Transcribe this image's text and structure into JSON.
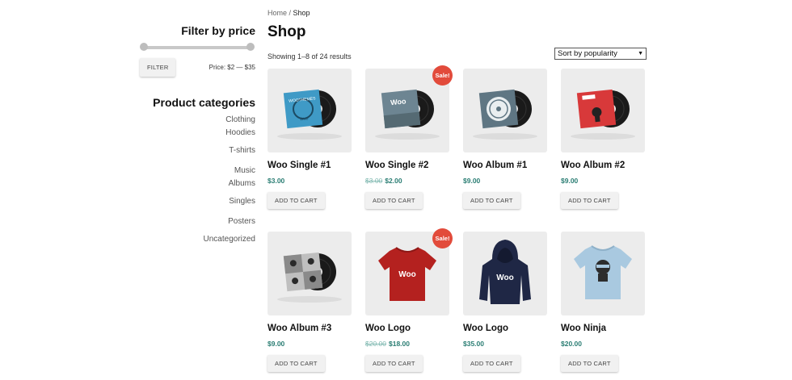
{
  "sidebar": {
    "filter_title": "Filter by price",
    "filter_button": "FILTER",
    "price_range": "Price: $2 — $35",
    "categories_title": "Product categories",
    "categories": [
      "Clothing",
      "Hoodies",
      "T-shirts",
      "Music",
      "Albums",
      "Singles",
      "Posters",
      "Uncategorized"
    ]
  },
  "breadcrumb": {
    "home": "Home",
    "sep": " / ",
    "current": "Shop"
  },
  "page_title": "Shop",
  "result_count": "Showing 1–8 of 24 results",
  "sort": {
    "selected": "Sort by popularity"
  },
  "products": [
    {
      "name": "Woo Single #1",
      "price": "$3.00",
      "old_price": "",
      "sale": "",
      "button": "ADD TO CART",
      "image": "vinyl-single-blue"
    },
    {
      "name": "Woo Single #2",
      "price": "$2.00",
      "old_price": "$3.00",
      "sale": "Sale!",
      "button": "ADD TO CART",
      "image": "vinyl-single-grey"
    },
    {
      "name": "Woo Album #1",
      "price": "$9.00",
      "old_price": "",
      "sale": "",
      "button": "ADD TO CART",
      "image": "vinyl-album-slate"
    },
    {
      "name": "Woo Album #2",
      "price": "$9.00",
      "old_price": "",
      "sale": "",
      "button": "ADD TO CART",
      "image": "vinyl-album-red"
    },
    {
      "name": "Woo Album #3",
      "price": "$9.00",
      "old_price": "",
      "sale": "",
      "button": "ADD TO CART",
      "image": "vinyl-album-checker"
    },
    {
      "name": "Woo Logo",
      "price": "$18.00",
      "old_price": "$20.00",
      "sale": "Sale!",
      "button": "ADD TO CART",
      "image": "red-tshirt"
    },
    {
      "name": "Woo Logo",
      "price": "$35.00",
      "old_price": "",
      "sale": "",
      "button": "ADD TO CART",
      "image": "navy-hoodie"
    },
    {
      "name": "Woo Ninja",
      "price": "$20.00",
      "old_price": "",
      "sale": "",
      "button": "ADD TO CART",
      "image": "lightblue-tshirt"
    }
  ],
  "colors": {
    "price": "#2a7d73",
    "sale_badge": "#e24b3b",
    "card_bg": "#ececec"
  }
}
